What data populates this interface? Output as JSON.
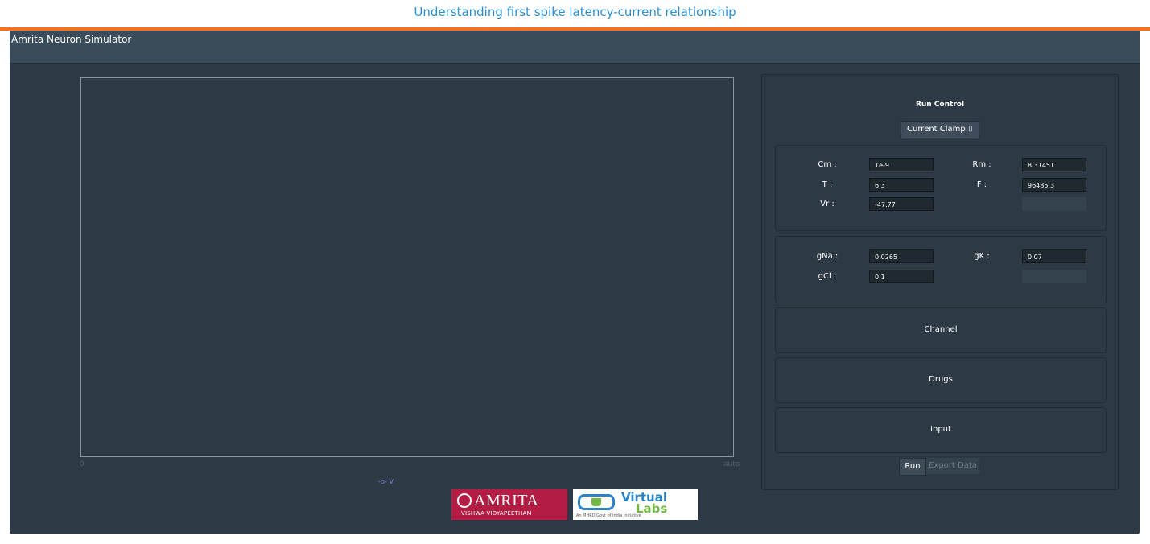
{
  "page": {
    "title": "Understanding first spike latency-current relationship"
  },
  "app": {
    "title": "Amrita Neuron Simulator"
  },
  "plot": {
    "x_axis_start": "0",
    "x_axis_end": "auto",
    "legend": "-o- V"
  },
  "logos": {
    "amrita_text": "AMRITA",
    "amrita_sub": "VISHWA VIDYAPEETHAM",
    "vlabs_word1": "Virtual",
    "vlabs_word2": "Labs",
    "vlabs_tagline": "An MHRD Govt of India Initiative"
  },
  "run_control": {
    "title": "Run Control",
    "mode": "Current Clamp ⌷",
    "params": {
      "cm_label": "Cm :",
      "cm_value": "1e-9",
      "rm_label": "Rm :",
      "rm_value": "8.31451",
      "t_label": "T :",
      "t_value": "6.3",
      "f_label": "F :",
      "f_value": "96485.3",
      "vr_label": "Vr :",
      "vr_value": "-47.77"
    },
    "conductances": {
      "gna_label": "gNa :",
      "gna_value": "0.0265",
      "gk_label": "gK :",
      "gk_value": "0.07",
      "gcl_label": "gCl :",
      "gcl_value": "0.1"
    },
    "sections": {
      "channel": "Channel",
      "drugs": "Drugs",
      "input": "Input"
    },
    "buttons": {
      "run": "Run",
      "export": "Export Data"
    }
  },
  "colors": {
    "accent_orange": "#f0731e",
    "title_blue": "#2a8fcf",
    "panel_bg": "#2d3a46",
    "header_bg": "#3a4b59"
  }
}
